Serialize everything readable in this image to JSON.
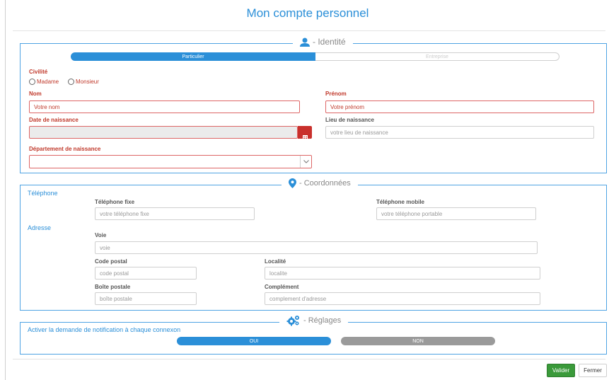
{
  "title": "Mon compte personnel",
  "identite": {
    "legend": "- Identité",
    "tab_particulier": "Particulier",
    "tab_entreprise": "Entreprise",
    "civilite_label": "Civilité",
    "radio_madame": "Madame",
    "radio_monsieur": "Monsieur",
    "nom_label": "Nom",
    "nom_placeholder": "Votre nom",
    "prenom_label": "Prénom",
    "prenom_placeholder": "Votre prénom",
    "date_label": "Date de naissance",
    "lieu_label": "Lieu de naissance",
    "lieu_placeholder": "votre lieu de naissance",
    "departement_label": "Département de naissance"
  },
  "coordonnees": {
    "legend": "- Coordonnées",
    "telephone_heading": "Téléphone",
    "tel_fixe_label": "Téléphone fixe",
    "tel_fixe_placeholder": "votre téléphone fixe",
    "tel_mobile_label": "Téléphone mobile",
    "tel_mobile_placeholder": "votre téléphone portable",
    "adresse_heading": "Adresse",
    "voie_label": "Voie",
    "voie_placeholder": "voie",
    "cp_label": "Code postal",
    "cp_placeholder": "code postal",
    "localite_label": "Localité",
    "localite_placeholder": "localite",
    "bp_label": "Boîte postale",
    "bp_placeholder": "boîte postale",
    "complement_label": "Complément",
    "complement_placeholder": "complement d'adresse"
  },
  "reglages": {
    "legend": "- Réglages",
    "notification_text": "Activer la demande de notification à chaque connexon",
    "oui": "OUI",
    "non": "NON"
  },
  "footer": {
    "valider": "Valider",
    "fermer": "Fermer"
  },
  "colors": {
    "accent": "#2b8fd8",
    "required": "#c0392b",
    "valider_bg": "#3a9a3a",
    "toggle_off": "#9a9a9a"
  }
}
